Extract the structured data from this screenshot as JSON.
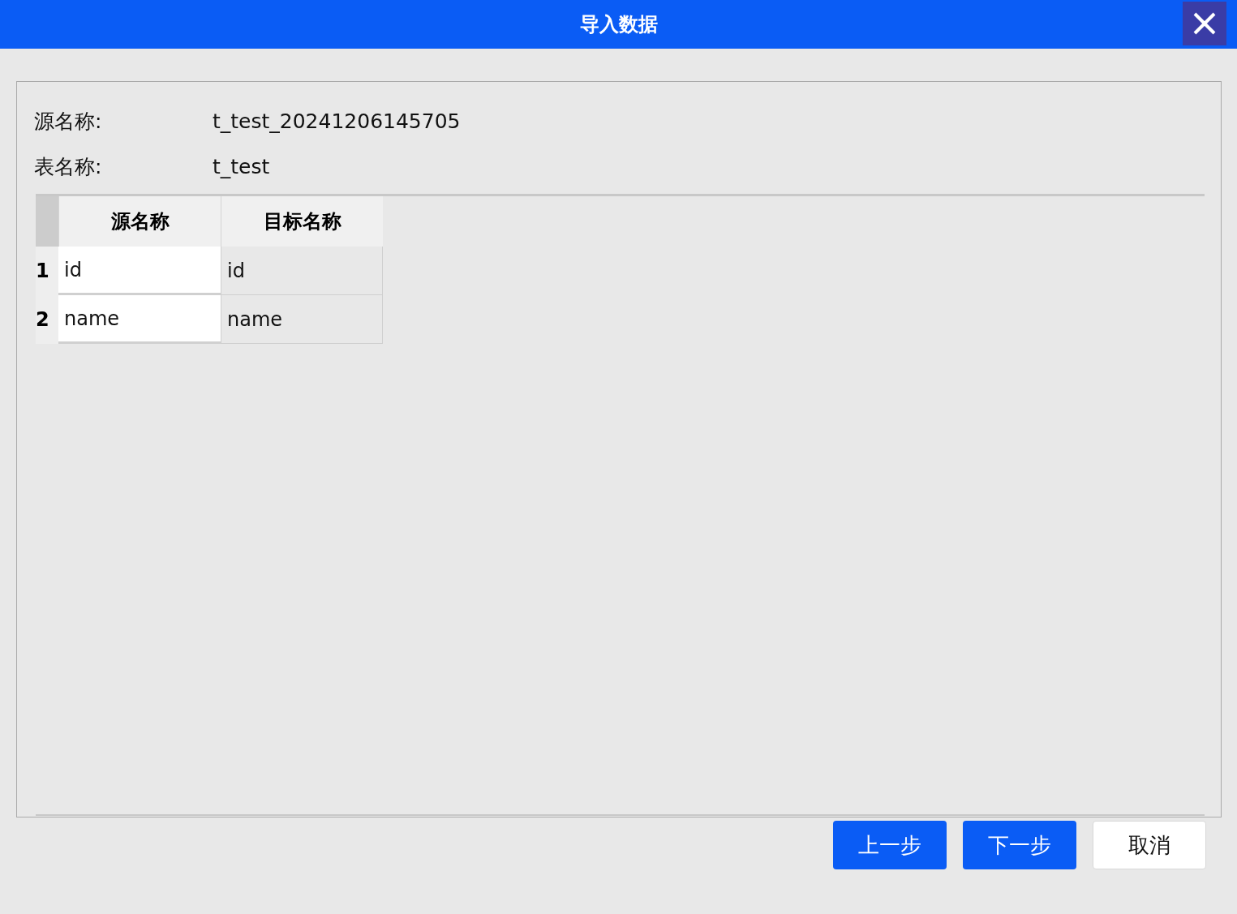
{
  "window": {
    "title": "导入数据"
  },
  "fields": [
    {
      "label": "源名称:",
      "value": "t_test_20241206145705"
    },
    {
      "label": "表名称:",
      "value": "t_test"
    }
  ],
  "table": {
    "columns": [
      {
        "label": "源名称",
        "kind": "editable"
      },
      {
        "label": "目标名称",
        "kind": "readonly"
      }
    ],
    "rows": [
      {
        "number": "1",
        "cells": [
          "id",
          "id"
        ]
      },
      {
        "number": "2",
        "cells": [
          "name",
          "name"
        ]
      }
    ]
  },
  "buttons": [
    {
      "label": "上一步",
      "kind": "primary"
    },
    {
      "label": "下一步",
      "kind": "primary"
    },
    {
      "label": "取消",
      "kind": "default"
    }
  ]
}
